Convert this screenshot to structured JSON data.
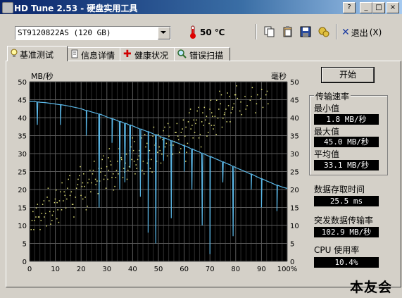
{
  "window": {
    "title": "HD Tune 2.53 - 硬盘实用工具",
    "help_btn": "?",
    "min_btn": "_",
    "max_btn": "□",
    "close_btn": "×"
  },
  "toolbar": {
    "drive": "ST9120822AS  (120 GB)",
    "temperature": "50 ℃",
    "exit_label": "退出",
    "exit_key": "(X)"
  },
  "tabs": [
    {
      "label": "基准测试",
      "active": true
    },
    {
      "label": "信息详情",
      "active": false
    },
    {
      "label": "健康状况",
      "active": false
    },
    {
      "label": "错误扫描",
      "active": false
    }
  ],
  "start_button": "开始",
  "stats": {
    "group_title": "传输速率",
    "min_label": "最小值",
    "min_value": "1.8 MB/秒",
    "max_label": "最大值",
    "max_value": "45.0 MB/秒",
    "avg_label": "平均值",
    "avg_value": "33.1 MB/秒",
    "access_label": "数据存取时间",
    "access_value": "25.5 ms",
    "burst_label": "突发数据传输率",
    "burst_value": "102.9 MB/秒",
    "cpu_label": "CPU 使用率",
    "cpu_value": "10.4%"
  },
  "watermark": "本友会",
  "colors": {
    "plot_bg": "#000000",
    "grid": "#5a5a5a",
    "transfer": "#5bb8e8",
    "access": "#e6e67a"
  },
  "chart_data": {
    "type": "line",
    "y_left_label": "MB/秒",
    "y_right_label": "毫秒",
    "x_ticks": [
      "0",
      "10",
      "20",
      "30",
      "40",
      "50",
      "60",
      "70",
      "80",
      "90",
      "100%"
    ],
    "y_ticks": [
      "0",
      "5",
      "10",
      "15",
      "20",
      "25",
      "30",
      "35",
      "40",
      "45",
      "50"
    ],
    "xlim": [
      0,
      100
    ],
    "ylim_left": [
      0,
      50
    ],
    "ylim_right": [
      0,
      50
    ],
    "grid": true,
    "series": [
      {
        "kind": "transfer_rate",
        "x": [
          0,
          2,
          4,
          6,
          8,
          10,
          12,
          14,
          16,
          18,
          20,
          22,
          24,
          26,
          28,
          30,
          32,
          34,
          36,
          38,
          40,
          42,
          44,
          46,
          48,
          50,
          52,
          54,
          56,
          58,
          60,
          62,
          64,
          66,
          68,
          70,
          72,
          74,
          76,
          78,
          80,
          82,
          84,
          86,
          88,
          90,
          92,
          94,
          96,
          98,
          100
        ],
        "y": [
          44.5,
          44.5,
          44.3,
          44.2,
          44.0,
          43.8,
          43.6,
          43.4,
          43.1,
          42.8,
          42.5,
          42.0,
          41.6,
          41.2,
          40.8,
          40.2,
          39.7,
          39.2,
          38.7,
          38.2,
          37.7,
          37.1,
          36.6,
          36.1,
          35.5,
          35.0,
          34.4,
          33.9,
          33.3,
          32.8,
          32.2,
          31.6,
          31.0,
          30.4,
          29.8,
          29.2,
          28.6,
          28.0,
          27.4,
          26.8,
          26.1,
          25.5,
          24.9,
          24.3,
          23.6,
          23.0,
          22.4,
          21.8,
          21.2,
          20.7,
          20.3
        ]
      },
      {
        "kind": "dropouts",
        "x": [
          3,
          12,
          22,
          27,
          32,
          35,
          37,
          39,
          43,
          46,
          49,
          52,
          55,
          60,
          63,
          67,
          70,
          75,
          79,
          86,
          90,
          96
        ],
        "y": [
          38,
          38,
          35,
          15,
          33,
          20,
          22,
          26,
          18,
          8,
          5,
          28,
          12,
          25,
          20,
          10,
          2,
          22,
          7,
          20,
          15,
          14
        ]
      },
      {
        "kind": "access_time_scatter",
        "x": [
          1,
          2,
          3,
          4,
          5,
          6,
          7,
          8,
          9,
          10,
          11,
          12,
          13,
          14,
          15,
          16,
          17,
          18,
          19,
          20,
          21,
          22,
          23,
          24,
          25,
          26,
          27,
          28,
          29,
          30,
          31,
          32,
          33,
          34,
          35,
          36,
          37,
          38,
          39,
          40,
          41,
          42,
          43,
          44,
          45,
          46,
          47,
          48,
          49,
          50,
          51,
          52,
          53,
          54,
          55,
          56,
          57,
          58,
          59,
          60,
          61,
          62,
          63,
          64,
          65,
          66,
          67,
          68,
          69,
          70,
          71,
          72,
          73,
          74,
          75,
          76,
          77,
          78,
          79,
          80,
          82,
          84,
          86,
          88,
          90,
          92
        ],
        "y": [
          12,
          10,
          14,
          11,
          16,
          13,
          18,
          12,
          15,
          19,
          14,
          17,
          20,
          16,
          22,
          18,
          15,
          21,
          24,
          19,
          23,
          17,
          25,
          22,
          26,
          20,
          24,
          28,
          23,
          26,
          29,
          25,
          22,
          27,
          31,
          26,
          28,
          24,
          30,
          33,
          27,
          29,
          32,
          26,
          34,
          30,
          28,
          35,
          31,
          33,
          29,
          36,
          32,
          38,
          30,
          34,
          37,
          33,
          39,
          35,
          31,
          40,
          36,
          38,
          42,
          35,
          39,
          41,
          37,
          44,
          40,
          38,
          43,
          45,
          39,
          41,
          46,
          42,
          44,
          47,
          43,
          45,
          48,
          44,
          46,
          45
        ]
      }
    ]
  }
}
